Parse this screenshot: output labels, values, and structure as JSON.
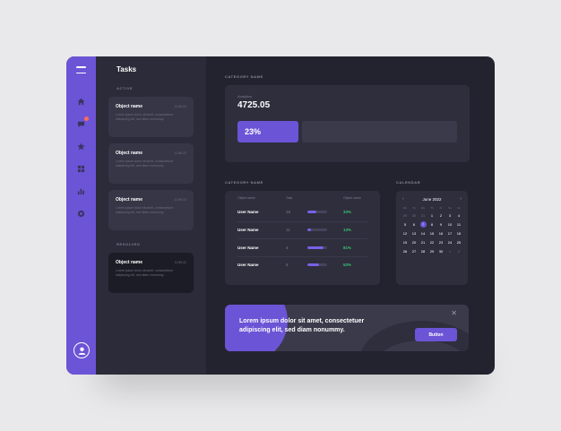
{
  "tasks": {
    "title": "Tasks",
    "active_label": "ACTIVE",
    "resolved_label": "RESOLVED",
    "active": [
      {
        "name": "Object name",
        "time": "11:55:22",
        "desc": "Lorem ipsum dolor sit amet, consectetuer adipiscing elit, sed diam nonummy."
      },
      {
        "name": "Object name",
        "time": "11:55:22",
        "desc": "Lorem ipsum dolor sit amet, consectetuer adipiscing elit, sed diam nonummy."
      },
      {
        "name": "Object name",
        "time": "11:55:22",
        "desc": "Lorem ipsum dolor sit amet, consectetuer adipiscing elit, sed diam nonummy."
      }
    ],
    "resolved": [
      {
        "name": "Object name",
        "time": "11:55:22",
        "desc": "Lorem ipsum dolor sit amet, consectetuer adipiscing elit, sed diam nonummy."
      }
    ]
  },
  "analytics": {
    "category_label": "CATEGORY NAME",
    "label": "Analytics",
    "value": "4725.05",
    "progress_text": "23%",
    "progress": 0.23
  },
  "table": {
    "category_label": "CATEGORY NAME",
    "headers": [
      "Object name",
      "Task",
      "",
      "Object name"
    ],
    "rows": [
      {
        "name": "User Name",
        "task": "15",
        "pct": "33%",
        "fill": 0.45
      },
      {
        "name": "User Name",
        "task": "11",
        "pct": "13%",
        "fill": 0.2
      },
      {
        "name": "User Name",
        "task": "4",
        "pct": "81%",
        "fill": 0.8
      },
      {
        "name": "User Name",
        "task": "6",
        "pct": "53%",
        "fill": 0.6
      }
    ]
  },
  "calendar": {
    "label": "CALENDAR",
    "month": "June 2022",
    "prev": "‹",
    "next": "›",
    "dow": [
      "Mo",
      "Tu",
      "We",
      "Th",
      "Fr",
      "Sa",
      "Su"
    ],
    "days": [
      {
        "d": "29",
        "m": true
      },
      {
        "d": "30",
        "m": true
      },
      {
        "d": "31",
        "m": true
      },
      {
        "d": "1"
      },
      {
        "d": "2"
      },
      {
        "d": "3"
      },
      {
        "d": "4"
      },
      {
        "d": "5"
      },
      {
        "d": "6"
      },
      {
        "d": "7",
        "s": true
      },
      {
        "d": "8"
      },
      {
        "d": "9"
      },
      {
        "d": "10"
      },
      {
        "d": "11"
      },
      {
        "d": "12"
      },
      {
        "d": "13"
      },
      {
        "d": "14"
      },
      {
        "d": "15"
      },
      {
        "d": "16"
      },
      {
        "d": "17"
      },
      {
        "d": "18"
      },
      {
        "d": "19"
      },
      {
        "d": "20"
      },
      {
        "d": "21"
      },
      {
        "d": "22"
      },
      {
        "d": "23"
      },
      {
        "d": "24"
      },
      {
        "d": "25"
      },
      {
        "d": "26"
      },
      {
        "d": "27"
      },
      {
        "d": "28"
      },
      {
        "d": "29"
      },
      {
        "d": "30"
      },
      {
        "d": "1",
        "m": true
      },
      {
        "d": "2",
        "m": true
      }
    ]
  },
  "banner": {
    "text": "Lorem ipsum dolor sit amet, consectetuer adipiscing elit, sed diam nonummy.",
    "button": "Button",
    "close": "✕"
  },
  "colors": {
    "accent": "#6c54d6",
    "success": "#3bc16f",
    "notification": "#ff6a5c"
  },
  "sidebar_icons": [
    "home-icon",
    "chat-icon",
    "star-icon",
    "grid-icon",
    "chart-icon",
    "settings-icon"
  ]
}
